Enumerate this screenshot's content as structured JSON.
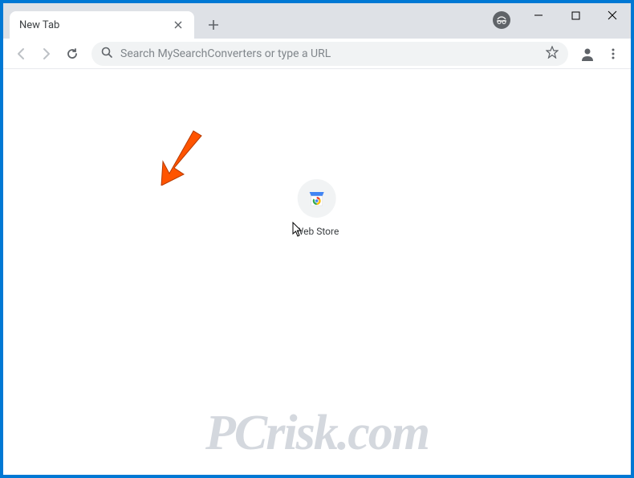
{
  "window": {
    "tab_title": "New Tab"
  },
  "toolbar": {
    "omnibox_placeholder": "Search MySearchConverters or type a URL"
  },
  "shortcuts": [
    {
      "label": "Web Store"
    }
  ],
  "watermark": "PCrisk.com",
  "icons": {
    "close": "close-icon",
    "plus": "plus-icon",
    "minimize": "minimize-icon",
    "maximize": "maximize-icon",
    "window_close": "window-close-icon",
    "back": "back-icon",
    "forward": "forward-icon",
    "reload": "reload-icon",
    "search": "search-icon",
    "star": "star-icon",
    "profile": "profile-icon",
    "menu": "menu-icon",
    "incognito": "incognito-icon"
  }
}
